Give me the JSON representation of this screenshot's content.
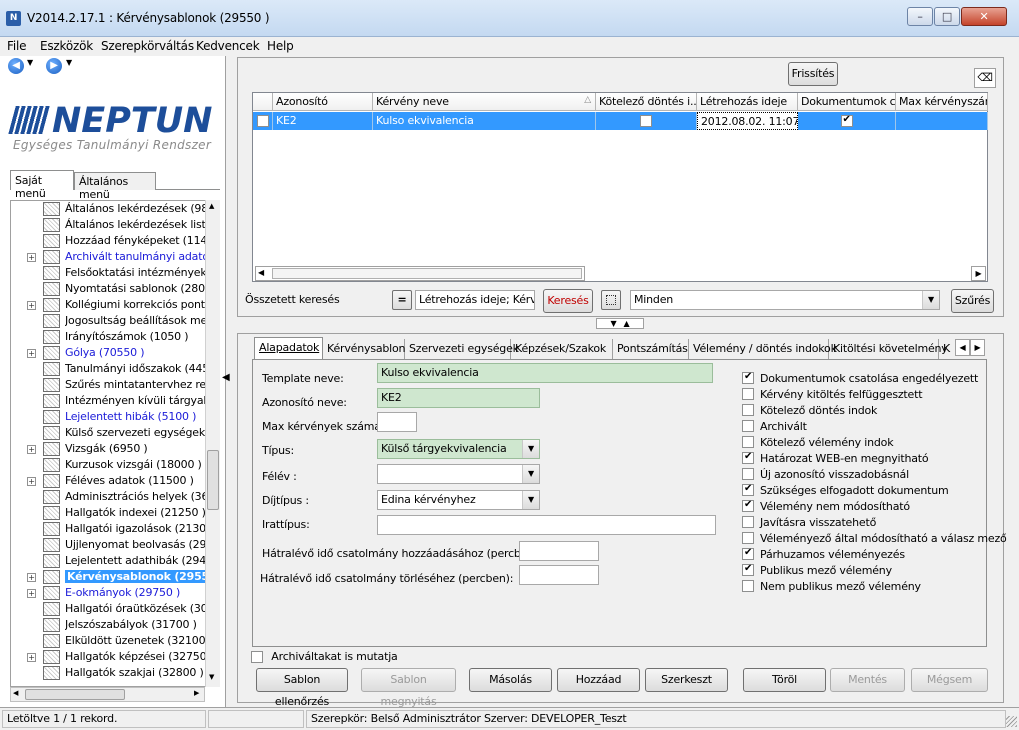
{
  "window": {
    "title": "V2014.2.17.1 : Kérvénysablonok (29550  )",
    "icon": "neptun-app-icon"
  },
  "menu": [
    "File",
    "Eszközök",
    "Szerepkörváltás",
    "Kedvencek",
    "Help"
  ],
  "logo": {
    "text": "NEPTUN",
    "subtitle": "Egységes Tanulmányi Rendszer"
  },
  "left_tabs": [
    "Saját menü",
    "Általános menü"
  ],
  "tree": [
    {
      "label": "Általános lekérdezések (9840",
      "exp": false,
      "style": "normal"
    },
    {
      "label": "Általános lekérdezések listája",
      "exp": false,
      "style": "normal"
    },
    {
      "label": "Hozzáad fényképeket (11400",
      "exp": false,
      "style": "normal"
    },
    {
      "label": "Archivált tanulmányi adatok (2",
      "exp": true,
      "style": "blue"
    },
    {
      "label": "Felsőoktatási intézmények list",
      "exp": false,
      "style": "normal"
    },
    {
      "label": "Nyomtatási sablonok (280000",
      "exp": false,
      "style": "normal"
    },
    {
      "label": "Kollégiumi korrekciós pontok (",
      "exp": true,
      "style": "normal"
    },
    {
      "label": "Jogosultság beállítások megte",
      "exp": false,
      "style": "normal"
    },
    {
      "label": "Irányítószámok (1050  )",
      "exp": false,
      "style": "normal"
    },
    {
      "label": "Gólya (70550  )",
      "exp": true,
      "style": "blue"
    },
    {
      "label": "Tanulmányi időszakok (4450",
      "exp": false,
      "style": "normal"
    },
    {
      "label": "Szűrés mintatantervhez rende",
      "exp": false,
      "style": "normal"
    },
    {
      "label": "Intézményen kívüli tárgyak (4",
      "exp": false,
      "style": "normal"
    },
    {
      "label": "Lejelentett hibák (5100  )",
      "exp": false,
      "style": "blue"
    },
    {
      "label": "Külső szervezeti egységek (6",
      "exp": false,
      "style": "normal"
    },
    {
      "label": "Vizsgák (6950  )",
      "exp": true,
      "style": "normal"
    },
    {
      "label": "Kurzusok vizsgái (18000  )",
      "exp": false,
      "style": "normal"
    },
    {
      "label": "Féléves adatok (11500  )",
      "exp": true,
      "style": "normal"
    },
    {
      "label": "Adminisztrációs helyek (3600",
      "exp": false,
      "style": "normal"
    },
    {
      "label": "Hallgatók indexei (21250  )",
      "exp": false,
      "style": "normal"
    },
    {
      "label": "Hallgatói igazolások (21300  )",
      "exp": false,
      "style": "normal"
    },
    {
      "label": "Ujjlenyomat beolvasás (29300",
      "exp": false,
      "style": "normal"
    },
    {
      "label": "Lejelentett adathibák (29450",
      "exp": false,
      "style": "normal"
    },
    {
      "label": "Kérvénysablonok (29550",
      "exp": true,
      "style": "selected"
    },
    {
      "label": "E-okmányok (29750  )",
      "exp": true,
      "style": "blue"
    },
    {
      "label": "Hallgatói óraütközések (3010",
      "exp": false,
      "style": "normal"
    },
    {
      "label": "Jelszószabályok (31700  )",
      "exp": false,
      "style": "normal"
    },
    {
      "label": "Elküldött üzenetek (32100  )",
      "exp": false,
      "style": "normal"
    },
    {
      "label": "Hallgatók képzései (32750  )",
      "exp": true,
      "style": "normal"
    },
    {
      "label": "Hallgatók szakjai (32800  )",
      "exp": false,
      "style": "normal"
    }
  ],
  "toolbar": {
    "refresh": "Frissítés"
  },
  "grid": {
    "headers": [
      "Azonosító",
      "Kérvény neve",
      "Kötelező döntés i...",
      "Létrehozás ideje",
      "Dokumentumok c...",
      "Max kérvényszám"
    ],
    "rows": [
      {
        "id": "KE2",
        "name": "Kulso ekvivalencia",
        "kotelezo": false,
        "created": "2012.08.02. 11:07:3",
        "dok": true,
        "max": ""
      }
    ]
  },
  "search": {
    "label": "Összetett keresés",
    "eq": "=",
    "field_value": "Létrehozás ideje; Kérvér",
    "search_btn": "Keresés",
    "combo_value": "Minden",
    "filter_btn": "Szűrés"
  },
  "tabs": [
    "Alapadatok",
    "Kérvénysablon",
    "Szervezeti egységek",
    "Képzések/Szakok",
    "Pontszámítás",
    "Vélemény / döntés indokok",
    "Kitöltési követelmény",
    "K"
  ],
  "form": {
    "template_label": "Template neve:",
    "template_value": "Kulso ekvivalencia",
    "azon_label": "Azonosító neve:",
    "azon_value": "KE2",
    "max_label": "Max kérvények száma:",
    "max_value": "",
    "tipus_label": "Típus:",
    "tipus_value": "Külső tárgyekvivalencia",
    "felev_label": "Félév :",
    "felev_value": "",
    "dij_label": "Díjtípus :",
    "dij_value": "Edina kérvényhez",
    "irat_label": "Irattípus:",
    "irat_value": "",
    "hatra1_label": "Hátralévő idő csatolmány hozzáadásához (percben):",
    "hatra1_value": "",
    "hatra2_label": "Hátralévő idő csatolmány törléséhez (percben):",
    "hatra2_value": ""
  },
  "checks": [
    {
      "label": "Dokumentumok csatolása engedélyezett",
      "on": true
    },
    {
      "label": "Kérvény kitöltés felfüggesztett",
      "on": false
    },
    {
      "label": "Kötelező döntés indok",
      "on": false
    },
    {
      "label": "Archivált",
      "on": false
    },
    {
      "label": "Kötelező vélemény indok",
      "on": false
    },
    {
      "label": "Határozat WEB-en megnyitható",
      "on": true
    },
    {
      "label": "Új azonosító visszadobásnál",
      "on": false
    },
    {
      "label": "Szükséges elfogadott dokumentum",
      "on": true
    },
    {
      "label": "Vélemény nem módosítható",
      "on": true
    },
    {
      "label": "Javításra visszatehető",
      "on": false
    },
    {
      "label": "Véleményező által módosítható a válasz mező",
      "on": false
    },
    {
      "label": "Párhuzamos véleményezés",
      "on": true
    },
    {
      "label": "Publikus mező vélemény",
      "on": true
    },
    {
      "label": "Nem publikus mező vélemény",
      "on": false
    }
  ],
  "archived_label": "Archiváltakat is mutatja",
  "buttons": [
    {
      "label": "Sablon ellenőrzés",
      "enabled": true
    },
    {
      "label": "Sablon megnyitás",
      "enabled": false
    },
    {
      "label": "Másolás",
      "enabled": true
    },
    {
      "label": "Hozzáad",
      "enabled": true
    },
    {
      "label": "Szerkeszt",
      "enabled": true
    },
    {
      "label": "Töröl",
      "enabled": true
    },
    {
      "label": "Mentés",
      "enabled": false
    },
    {
      "label": "Mégsem",
      "enabled": false
    }
  ],
  "status": {
    "left": "Letöltve 1 / 1 rekord.",
    "role": "Szerepkör: Belső Adminisztrátor  Szerver: DEVELOPER_Teszt"
  }
}
